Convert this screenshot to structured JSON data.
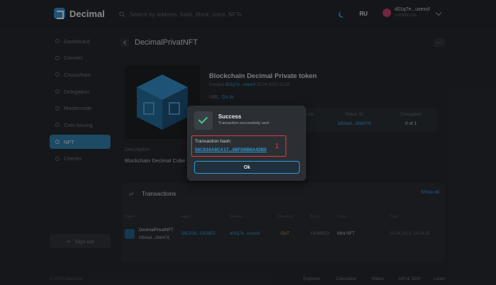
{
  "app": {
    "name": "Decimal"
  },
  "header": {
    "search_placeholder": "Search by address, hash, block, coins, NFTs",
    "language": "RU",
    "account_name": "d01q7e...uxexsf",
    "account_sub": "0.000000 DEL"
  },
  "sidebar": {
    "items": [
      {
        "label": "Dashboard"
      },
      {
        "label": "Convert"
      },
      {
        "label": "Crosschain"
      },
      {
        "label": "Delegation"
      },
      {
        "label": "Masternode"
      },
      {
        "label": "Coin issuing"
      },
      {
        "label": "NFT",
        "active": true
      },
      {
        "label": "Checks"
      }
    ],
    "sign_out": "Sign out",
    "copyright": "© 2023 Decimal"
  },
  "page": {
    "title": "DecimalPrivatNFT",
    "token_title": "Blockchain Decimal Private token",
    "created_prefix": "Created",
    "created_address": "d01q7e...uxexsf",
    "created_date": "25.04.2023 15:25",
    "url_label": "URL:",
    "url_value": "Go to",
    "stats": [
      {
        "label": "Reserve",
        "value": ""
      },
      {
        "label": "Token ID",
        "value": "fd54ad...8b8476"
      },
      {
        "label": "Delegated",
        "value": "0 of 1"
      }
    ],
    "description_label": "Description",
    "description_value": "Blockchain Decimal Cube"
  },
  "transactions": {
    "title": "Transactions",
    "show_all": "Show all",
    "columns": [
      "Token",
      "Hash",
      "Sender",
      "Direction",
      "Block",
      "Type",
      "Time"
    ],
    "rows": [
      {
        "token_name": "DecimalPrivatNFT",
        "token_id": "fd54ad...8b8476",
        "hash": "56C818...D828E5",
        "sender": "d01q7e...uxexsf",
        "direction": "OUT",
        "block": "14096533",
        "type": "Mint NFT",
        "time": "25.04.2023, 15:24:35"
      }
    ]
  },
  "footer": {
    "links": [
      "Explorer",
      "Calculator",
      "Status",
      "API & SDK",
      "Learn"
    ]
  },
  "modal": {
    "title": "Success",
    "subtitle": "Transaction successfully sent",
    "hash_label": "Transaction hash:",
    "hash_value": "56C816A8CA17...68FD6B6A42B5",
    "annotation": "1",
    "ok_label": "Ok"
  },
  "colors": {
    "accent": "#2c9cdb",
    "success": "#3ec98a",
    "highlight": "#e0393e",
    "background": "#1f2226"
  }
}
